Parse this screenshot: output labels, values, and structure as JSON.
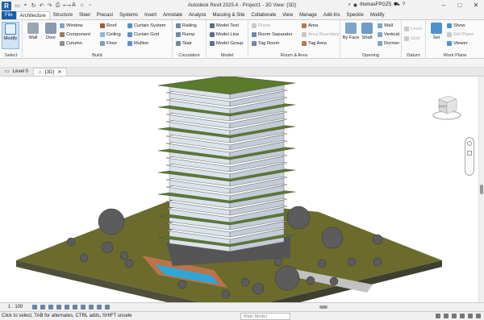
{
  "app": {
    "title": "Autodesk Revit 2025.4 - Project1 - 3D View: {3D}",
    "user": "thomasFPGZ5"
  },
  "tabs": [
    "File",
    "Architecture",
    "Structure",
    "Steel",
    "Precast",
    "Systems",
    "Insert",
    "Annotate",
    "Analyze",
    "Massing & Site",
    "Collaborate",
    "View",
    "Manage",
    "Add-Ins",
    "Speckle",
    "Modify"
  ],
  "active_tab": "Architecture",
  "ribbon": {
    "select": {
      "modify": "Modify",
      "label": "Select"
    },
    "build": {
      "wall": "Wall",
      "door": "Door",
      "window": "Window",
      "component": "Component",
      "column": "Column",
      "roof": "Roof",
      "ceiling": "Ceiling",
      "floor": "Floor",
      "curtain_system": "Curtain  System",
      "curtain_grid": "Curtain  Grid",
      "mullion": "Mullion",
      "label": "Build"
    },
    "circulation": {
      "railing": "Railing",
      "ramp": "Ramp",
      "stair": "Stair",
      "label": "Circulation"
    },
    "model": {
      "text": "Model  Text",
      "line": "Model  Line",
      "group": "Model  Group",
      "label": "Model"
    },
    "room_area": {
      "room": "Room",
      "separator": "Room  Separator",
      "tag_room": "Tag  Room",
      "area": "Area",
      "area_boundary": "Area  Boundary",
      "tag_area": "Tag  Area",
      "label": "Room & Area"
    },
    "opening": {
      "by_face": "By Face",
      "shaft": "Shaft",
      "wall": "Wall",
      "vertical": "Vertical",
      "dormer": "Dormer",
      "label": "Opening"
    },
    "datum": {
      "level": "Level",
      "grid": "Grid",
      "label": "Datum"
    },
    "workplane": {
      "set": "Set",
      "show": "Show",
      "ref_plane": "Ref  Plane",
      "viewer": "Viewer",
      "label": "Work Plane"
    }
  },
  "view_tabs": [
    "Level 0",
    "{3D}"
  ],
  "viewcube_face": "BACK",
  "view_control": {
    "scale": "1 : 100"
  },
  "status": {
    "hint": "Click to select, TAB for alternates, CTRL adds, SHIFT unsele",
    "workset": "Main Model"
  },
  "colors": {
    "file_tab": "#1a5eaa",
    "ground": "#6b6b2e",
    "ground_edge": "#4f4f3b",
    "water": "#2fa6d9",
    "deck": "#b8744a"
  }
}
